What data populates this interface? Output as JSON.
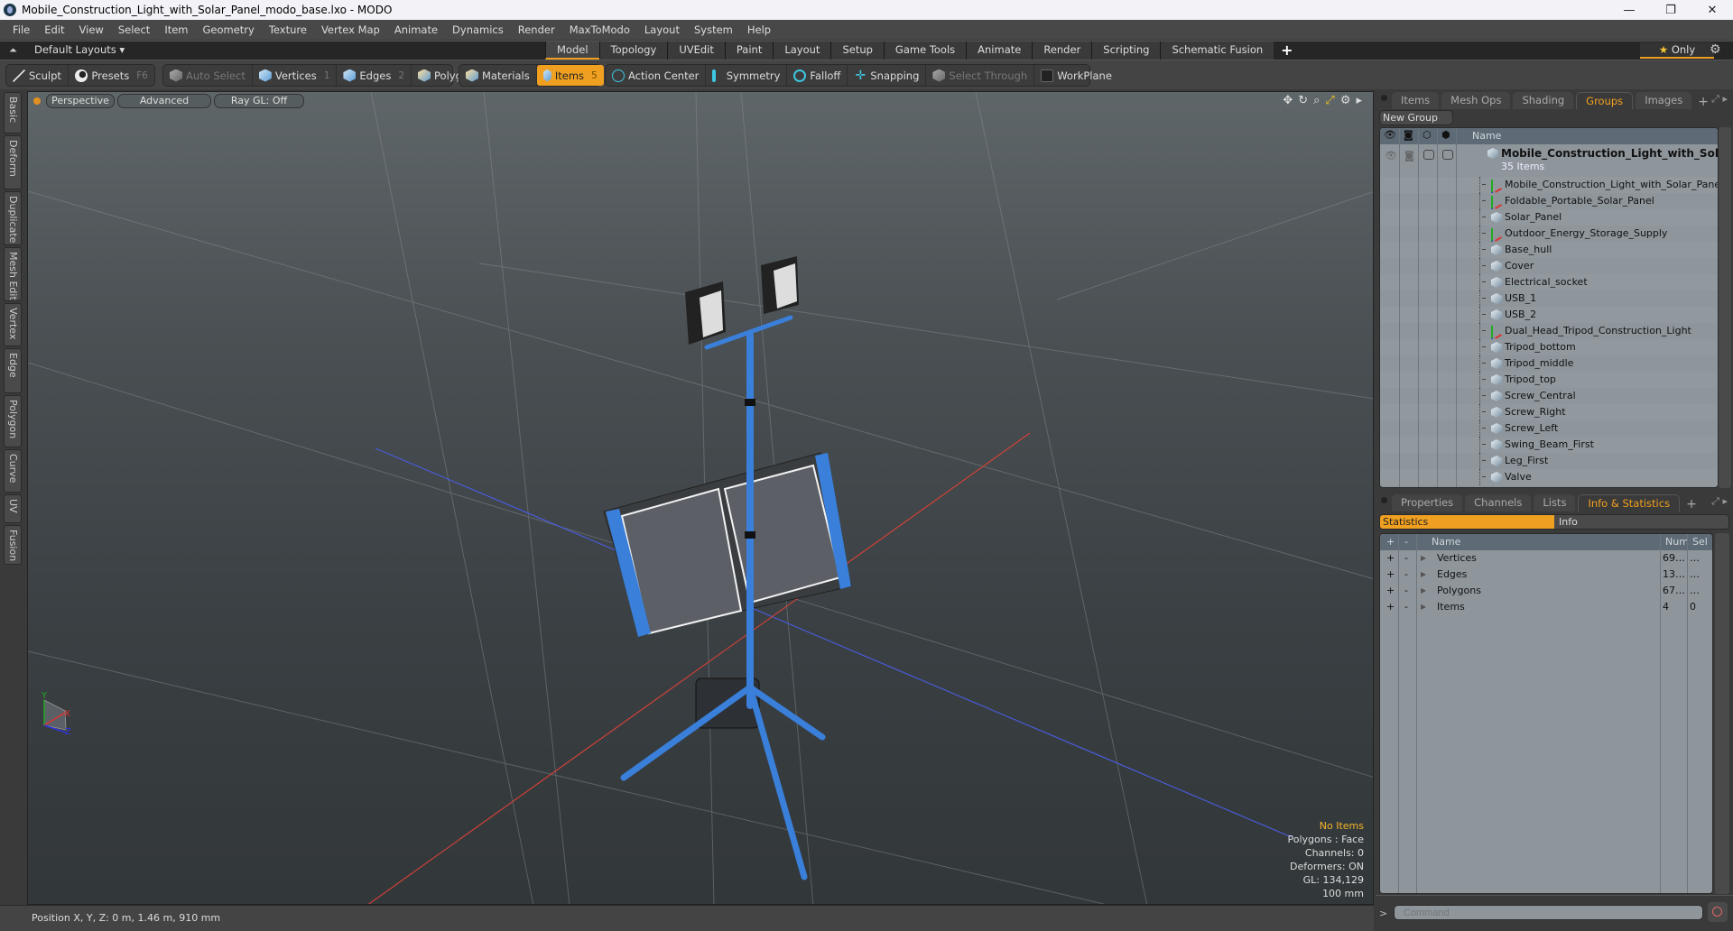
{
  "window": {
    "title": "Mobile_Construction_Light_with_Solar_Panel_modo_base.lxo - MODO",
    "controls": {
      "minimize": "—",
      "maximize": "❐",
      "close": "✕"
    }
  },
  "menu": [
    "File",
    "Edit",
    "View",
    "Select",
    "Item",
    "Geometry",
    "Texture",
    "Vertex Map",
    "Animate",
    "Dynamics",
    "Render",
    "MaxToModo",
    "Layout",
    "System",
    "Help"
  ],
  "layoutbar": {
    "layout_name": "Default Layouts ▾",
    "tabs": [
      {
        "label": "Model",
        "active": true
      },
      {
        "label": "Topology"
      },
      {
        "label": "UVEdit"
      },
      {
        "label": "Paint"
      },
      {
        "label": "Layout"
      },
      {
        "label": "Setup"
      },
      {
        "label": "Game Tools"
      },
      {
        "label": "Animate"
      },
      {
        "label": "Render"
      },
      {
        "label": "Scripting"
      },
      {
        "label": "Schematic Fusion"
      }
    ],
    "add_tab": "+",
    "only_label": "Only",
    "only_icon": "★"
  },
  "toolbar": {
    "sculpt": "Sculpt",
    "presets": "Presets",
    "presets_key": "F6",
    "auto_select": "Auto Select",
    "vertices": "Vertices",
    "vertices_key": "1",
    "edges": "Edges",
    "edges_key": "2",
    "polygons": "Polygons",
    "materials": "Materials",
    "items": "Items",
    "items_key": "5",
    "action_center": "Action Center",
    "symmetry": "Symmetry",
    "falloff": "Falloff",
    "snapping": "Snapping",
    "select_through": "Select Through",
    "workplane": "WorkPlane"
  },
  "left_tabs": [
    "Basic",
    "Deform",
    "Duplicate",
    "Mesh Edit",
    "Vertex",
    "Edge",
    "Polygon",
    "Curve",
    "UV",
    "Fusion"
  ],
  "viewport": {
    "view_mode": "Perspective",
    "shading": "Advanced",
    "raygl": "Ray GL: Off",
    "info": {
      "selection": "No Items",
      "polygons": "Polygons : Face",
      "channels": "Channels: 0",
      "deformers": "Deformers: ON",
      "gl": "GL: 134,129",
      "grid": "100 mm"
    },
    "axis_labels": {
      "x": "X",
      "y": "Y",
      "z": "Z"
    }
  },
  "status": {
    "position": "Position X, Y, Z:   0 m, 1.46 m, 910 mm"
  },
  "groups_panel": {
    "tabs": [
      {
        "label": "Items"
      },
      {
        "label": "Mesh Ops"
      },
      {
        "label": "Shading"
      },
      {
        "label": "Groups",
        "active": true
      },
      {
        "label": "Images"
      }
    ],
    "add_tab": "+",
    "new_group": "New Group",
    "column_name": "Name",
    "root": {
      "name": "Mobile_Construction_Light_with_Solar_P...",
      "count": "35 Items"
    },
    "items": [
      {
        "name": "Mobile_Construction_Light_with_Solar_Panel",
        "type": "locator"
      },
      {
        "name": "Foldable_Portable_Solar_Panel",
        "type": "locator"
      },
      {
        "name": "Solar_Panel",
        "type": "mesh"
      },
      {
        "name": "Outdoor_Energy_Storage_Supply",
        "type": "locator"
      },
      {
        "name": "Base_hull",
        "type": "mesh"
      },
      {
        "name": "Cover",
        "type": "mesh"
      },
      {
        "name": "Electrical_socket",
        "type": "mesh"
      },
      {
        "name": "USB_1",
        "type": "mesh"
      },
      {
        "name": "USB_2",
        "type": "mesh"
      },
      {
        "name": "Dual_Head_Tripod_Construction_Light",
        "type": "locator"
      },
      {
        "name": "Tripod_bottom",
        "type": "mesh"
      },
      {
        "name": "Tripod_middle",
        "type": "mesh"
      },
      {
        "name": "Tripod_top",
        "type": "mesh"
      },
      {
        "name": "Screw_Central",
        "type": "mesh"
      },
      {
        "name": "Screw_Right",
        "type": "mesh"
      },
      {
        "name": "Screw_Left",
        "type": "mesh"
      },
      {
        "name": "Swing_Beam_First",
        "type": "mesh"
      },
      {
        "name": "Leg_First",
        "type": "mesh"
      },
      {
        "name": "Valve",
        "type": "mesh"
      }
    ]
  },
  "info_panel": {
    "tabs": [
      {
        "label": "Properties"
      },
      {
        "label": "Channels"
      },
      {
        "label": "Lists"
      },
      {
        "label": "Info & Statistics",
        "active": true
      }
    ],
    "add_tab": "+",
    "subtabs": {
      "statistics": "Statistics",
      "info": "Info"
    },
    "columns": {
      "plus": "+",
      "minus": "-",
      "name": "Name",
      "num": "Num",
      "sel": "Sel"
    },
    "rows": [
      {
        "name": "Vertices",
        "num": "69…",
        "sel": "…"
      },
      {
        "name": "Edges",
        "num": "13…",
        "sel": "…"
      },
      {
        "name": "Polygons",
        "num": "67…",
        "sel": "…"
      },
      {
        "name": "Items",
        "num": "4",
        "sel": "0"
      }
    ]
  },
  "command": {
    "prompt": ">",
    "placeholder": "Command"
  },
  "colors": {
    "accent": "#f0a020",
    "model_blue": "#3a7fd9",
    "axis_x": "#d0413a",
    "axis_z": "#4a5bd6"
  }
}
